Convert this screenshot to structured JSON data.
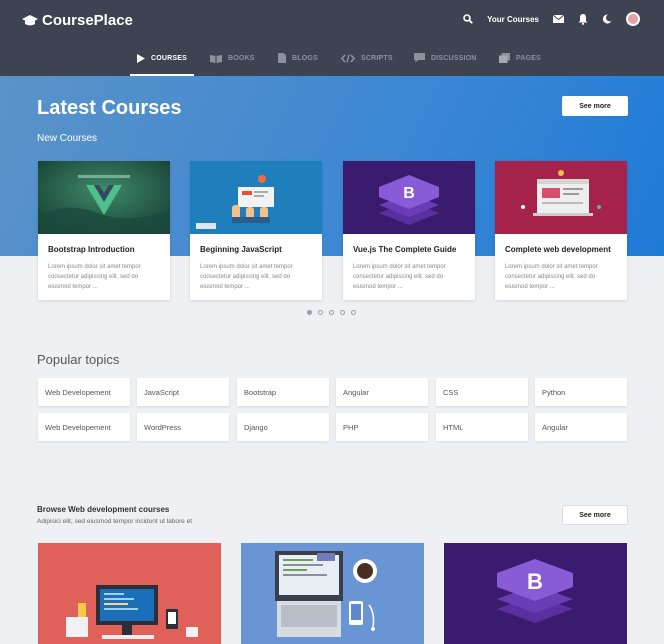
{
  "header": {
    "brand": "CoursePlace",
    "your_courses": "Your Courses",
    "icons": [
      "search-icon",
      "mail-icon",
      "bell-icon",
      "moon-icon",
      "avatar"
    ]
  },
  "subnav": {
    "tabs": [
      {
        "label": "COURSES",
        "icon": "play-icon",
        "active": true
      },
      {
        "label": "BOOKS",
        "icon": "book-icon",
        "active": false
      },
      {
        "label": "BLOGS",
        "icon": "document-icon",
        "active": false
      },
      {
        "label": "SCRIPTS",
        "icon": "code-icon",
        "active": false
      },
      {
        "label": "DISCUSSION",
        "icon": "chat-icon",
        "active": false
      },
      {
        "label": "PAGES",
        "icon": "pages-icon",
        "active": false
      }
    ]
  },
  "hero": {
    "title": "Latest Courses",
    "subtitle": "New Courses",
    "see_more": "See more",
    "courses": [
      {
        "title": "Bootstrap Introduction",
        "desc": "Lorem ipsum dolor sit amet tempor consectetur adipiscing elit, sed do eiusmod tempor ..."
      },
      {
        "title": "Beginning JavaScript",
        "desc": "Lorem ipsum dolor sit amet tempor consectetur adipiscing elit, sed do eiusmod tempor ..."
      },
      {
        "title": "Vue.js The Complete Guide",
        "desc": "Lorem ipsum dolor sit amet tempor consectetur adipiscing elit, sed do eiusmod tempor ..."
      },
      {
        "title": "Complete web development",
        "desc": "Lorem ipsum dolor sit amet tempor consectetur adipiscing elit, sed do eiusmod tempor ..."
      }
    ],
    "carousel_count": 5,
    "carousel_active": 1
  },
  "popular": {
    "title": "Popular topics",
    "topics": [
      "Web Developement",
      "JavaScript",
      "Bootstrap",
      "Angular",
      "CSS",
      "Python",
      "Web Developement",
      "WordPress",
      "Django",
      "PHP",
      "HTML",
      "Angular"
    ]
  },
  "browse": {
    "title": "Browse Web development courses",
    "subtitle": "Adipisici elit, sed eiusmod tempor incidunt ut labore et",
    "see_more": "See more"
  },
  "colors": {
    "header_bg": "#3d4350",
    "hero_blue": "#3b86d4",
    "bootstrap_purple": "#3a1b6e"
  }
}
